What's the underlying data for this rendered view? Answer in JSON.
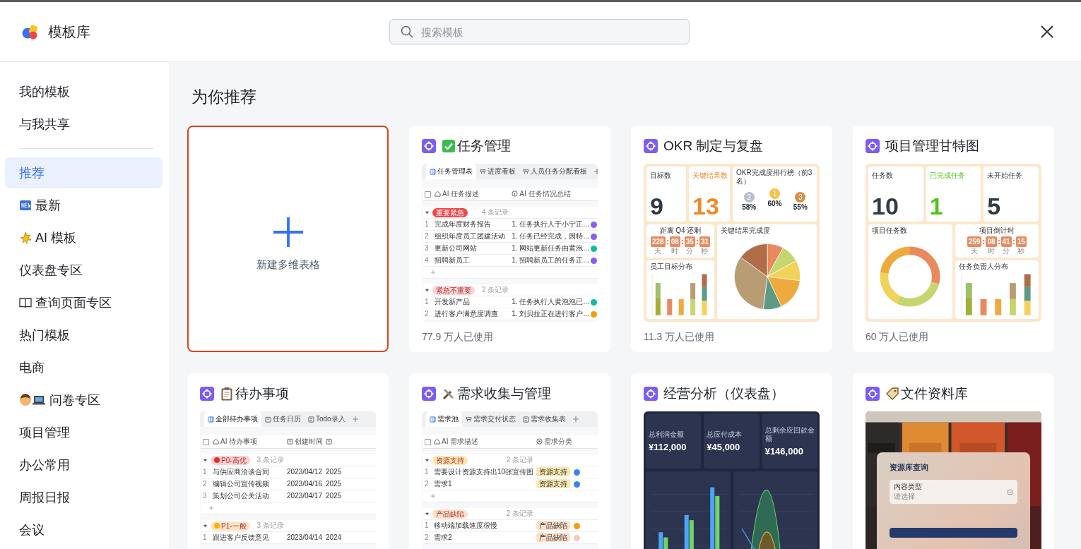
{
  "header": {
    "title": "模板库",
    "search": {
      "placeholder": "搜索模板"
    }
  },
  "sidebar": {
    "groups": [
      [
        {
          "label": "我的模板",
          "kind": "plain",
          "selected": false
        },
        {
          "label": "与我共享",
          "kind": "plain",
          "selected": false
        }
      ],
      [
        {
          "label": "推荐",
          "kind": "plain",
          "selected": true
        },
        {
          "label": "最新",
          "kind": "new",
          "selected": false
        },
        {
          "label": "AI 模板",
          "kind": "sparkle",
          "selected": false
        },
        {
          "label": "仪表盘专区",
          "kind": "plain",
          "selected": false
        },
        {
          "label": "查询页面专区",
          "kind": "book",
          "selected": false
        },
        {
          "label": "热门模板",
          "kind": "plain",
          "selected": false
        },
        {
          "label": "电商",
          "kind": "plain",
          "selected": false
        },
        {
          "label": "问卷专区",
          "kind": "survey",
          "selected": false
        },
        {
          "label": "项目管理",
          "kind": "plain",
          "selected": false
        },
        {
          "label": "办公常用",
          "kind": "plain",
          "selected": false
        },
        {
          "label": "周报日报",
          "kind": "plain",
          "selected": false
        },
        {
          "label": "会议",
          "kind": "plain",
          "selected": false
        }
      ]
    ]
  },
  "main": {
    "heading": "为你推荐",
    "cards": [
      {
        "kind": "new",
        "label": "新建多维表格",
        "selected": true
      },
      {
        "kind": "table",
        "title": "任务管理",
        "selected": false,
        "usage": "77.9 万人已使用",
        "preview": {
          "tabs": [
            {
              "label": "任务管理表",
              "selected": true
            },
            {
              "label": "进度看板",
              "selected": false
            },
            {
              "label": "人员任务分配看板",
              "selected": false
            }
          ],
          "checked": false,
          "columns": [
            {
              "label": "AI 任务描述",
              "kind": "text"
            },
            {
              "label": "AI 任务情况总结",
              "kind": "text"
            }
          ],
          "groups": [
            {
              "tag": "重要紧急",
              "color": "#f0484a",
              "count": "4 条记录",
              "rows": [
                {
                  "num": "1",
                  "cells": [
                    "完成年度财务报告",
                    "1. 任务执行人于小宁正..."
                  ],
                  "color": "#8b5cf6"
                },
                {
                  "num": "2",
                  "cells": [
                    "组织年度员工团建活动",
                    "1. 任务已经完成，因特..."
                  ],
                  "color": "#8b5cf6"
                },
                {
                  "num": "3",
                  "cells": [
                    "更新公司网站",
                    "1. 网站更新任务由黄泡..."
                  ],
                  "color": "#14b8a6"
                },
                {
                  "num": "4",
                  "cells": [
                    "招聘新员工",
                    "1. 招聘新员工的任务正..."
                  ],
                  "color": "#8b5cf6"
                }
              ]
            },
            {
              "tag": "紧急不重要",
              "color": "#fcd4d4",
              "count": "2 条记录",
              "rows": [
                {
                  "num": "1",
                  "cells": [
                    "开发新产品",
                    "1. 任务执行人黄泡泡已..."
                  ],
                  "color": "#14b8a6"
                },
                {
                  "num": "2",
                  "cells": [
                    "进行客户满意度调查",
                    "1. 刘贝拉正在进行客户..."
                  ],
                  "color": "#f59e0b"
                }
              ]
            }
          ]
        }
      },
      {
        "kind": "okr",
        "title": "OKR 制定与复盘",
        "selected": false,
        "usage": "11.3 万人已使用",
        "preview": {
          "stats": [
            {
              "label": "目标数",
              "value": "9",
              "color": "#333a44"
            },
            {
              "label": "关键结果数",
              "value": "13",
              "color": "#f0892c"
            }
          ],
          "ranking": {
            "title": "OKR完成度排行榜（前3名）",
            "items": [
              {
                "rank": "2",
                "value": "58%",
                "color": "#b8bfcc"
              },
              {
                "rank": "1",
                "value": "60%",
                "color": "#f5c344"
              },
              {
                "rank": "3",
                "value": "55%",
                "color": "#d98c4a"
              }
            ]
          },
          "countdown": {
            "title": "距离 Q4 还剩",
            "units": [
              {
                "value": "228",
                "unit": "天"
              },
              {
                "value": "08",
                "unit": "时"
              },
              {
                "value": "35",
                "unit": "分"
              },
              {
                "value": "31",
                "unit": "秒"
              }
            ]
          },
          "charts": [
            {
              "title": "员工目标分布",
              "kind": "bar"
            },
            {
              "title": "关键结果完成度",
              "kind": "pie"
            }
          ]
        }
      },
      {
        "kind": "gantt",
        "title": "项目管理甘特图",
        "selected": false,
        "usage": "60 万人已使用",
        "preview": {
          "stats": [
            {
              "label": "任务数",
              "value": "10",
              "color": "#333a44"
            },
            {
              "label": "已完成任务",
              "value": "1",
              "color": "#52c41a"
            },
            {
              "label": "未开始任务",
              "value": "5",
              "color": "#333a44"
            }
          ],
          "countdown": {
            "title": "项目倒计时",
            "units": [
              {
                "value": "259",
                "unit": "天"
              },
              {
                "value": "08",
                "unit": "时"
              },
              {
                "value": "41",
                "unit": "分"
              },
              {
                "value": "15",
                "unit": "秒"
              }
            ]
          },
          "charts": [
            {
              "title": "项目任务数",
              "kind": "donut"
            },
            {
              "title": "任务负责人分布",
              "kind": "bar"
            }
          ]
        }
      },
      {
        "kind": "table",
        "title": "待办事项",
        "selected": false,
        "preview": {
          "tabs": [
            {
              "label": "全部待办事项",
              "selected": true
            },
            {
              "label": "任务日历",
              "selected": false
            },
            {
              "label": "Todo录入",
              "selected": false
            }
          ],
          "checked": false,
          "columns": [
            {
              "label": "AI 待办事项",
              "kind": "text"
            },
            {
              "label": "创建时间",
              "kind": "text"
            }
          ],
          "groups": [
            {
              "tag": "P0-高优",
              "color": "#fcd0d0",
              "dot": {
                "color": "#e02f2f"
              },
              "count": "3 条记录",
              "rows": [
                {
                  "num": "1",
                  "cells": [
                    "与供应商洽谈合同",
                    "2023/04/12",
                    "2025"
                  ]
                },
                {
                  "num": "2",
                  "cells": [
                    "编辑公司宣传视频",
                    "2023/04/16",
                    "2025"
                  ]
                },
                {
                  "num": "3",
                  "cells": [
                    "策划公司公关活动",
                    "2023/04/17",
                    "2025"
                  ]
                }
              ]
            },
            {
              "tag": "P1-一般",
              "color": "#fde3c4",
              "dot": {
                "color": "#f7b500"
              },
              "count": "3 条记录",
              "rows": [
                {
                  "num": "1",
                  "cells": [
                    "跟进客户反馈意见",
                    "2023/04/14",
                    "2024"
                  ]
                }
              ]
            }
          ]
        }
      },
      {
        "kind": "table",
        "title": "需求收集与管理",
        "selected": false,
        "preview": {
          "tabs": [
            {
              "label": "需求池",
              "selected": true
            },
            {
              "label": "需求交付状态",
              "selected": false
            },
            {
              "label": "需求收集表",
              "selected": false
            }
          ],
          "checked": false,
          "columns": [
            {
              "label": "AI 需求描述",
              "kind": "text"
            },
            {
              "label": "需求分类",
              "kind": "tag"
            }
          ],
          "groups": [
            {
              "tag": "资源支持",
              "color": "#fbe7b0",
              "count": "2 条记录",
              "rows": [
                {
                  "num": "1",
                  "cells": [
                    "需要设计资源支持出10张宣传图",
                    "资源支持"
                  ],
                  "color": "#3b82f6"
                },
                {
                  "num": "2",
                  "cells": [
                    "需求1",
                    "资源支持"
                  ],
                  "color": "#3b82f6"
                }
              ]
            },
            {
              "tag": "产品缺陷",
              "color": "#fde0c8",
              "count": "2 条记录",
              "rows": [
                {
                  "num": "1",
                  "cells": [
                    "移动端加载速度很慢",
                    "产品缺陷"
                  ],
                  "color": "#f59e0b"
                },
                {
                  "num": "2",
                  "cells": [
                    "需求2",
                    "产品缺陷"
                  ],
                  "color": "#f9c9c0"
                }
              ]
            }
          ]
        }
      },
      {
        "kind": "dark",
        "title": "经营分析（仪表盘）",
        "selected": false,
        "preview": {
          "stats": [
            {
              "label": "总利润金额",
              "value": "¥112,000"
            },
            {
              "label": "总应付成本",
              "value": "¥45,000"
            },
            {
              "label": "总剩余应回款金额",
              "value": "¥146,000"
            }
          ],
          "charts": [
            {
              "kind": "bar"
            },
            {
              "kind": "wave"
            }
          ]
        }
      },
      {
        "kind": "query",
        "title": "文件资料库",
        "selected": false,
        "preview": {
          "dialog_title": "资源库查询",
          "field_label": "内容类型",
          "placeholder": "请选择"
        }
      }
    ]
  }
}
